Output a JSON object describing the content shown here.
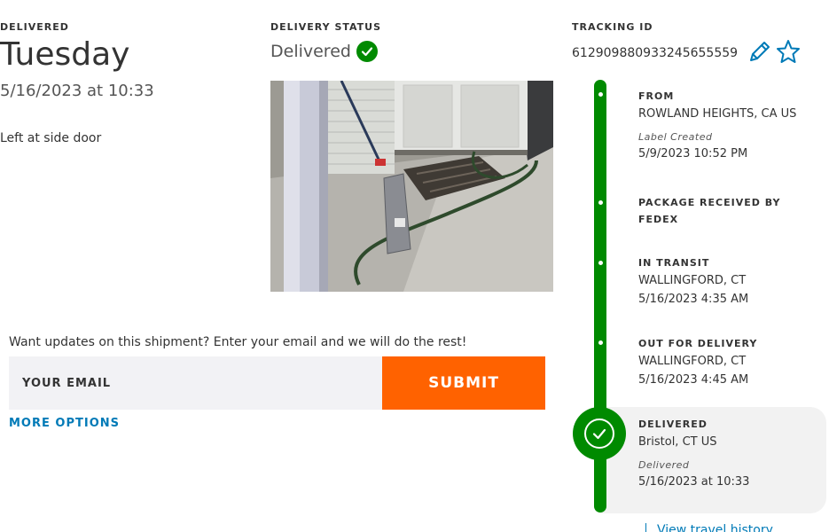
{
  "delivery": {
    "label": "DELIVERED",
    "day": "Tuesday",
    "datetime": "5/16/2023 at 10:33",
    "note": "Left at side door"
  },
  "status": {
    "label": "DELIVERY STATUS",
    "value": "Delivered",
    "icon": "check-circle-icon",
    "color": "#008a00"
  },
  "tracking": {
    "label": "TRACKING ID",
    "number": "612909880933245655559"
  },
  "updates": {
    "prompt": "Want updates on this shipment? Enter your email and we will do the rest!",
    "email_placeholder": "YOUR EMAIL",
    "submit_label": "SUBMIT",
    "more_options": "MORE OPTIONS"
  },
  "timeline": {
    "color": "#008a00",
    "events": [
      {
        "title": "FROM",
        "lines": [
          "ROWLAND HEIGHTS, CA US"
        ],
        "sublabel": "Label Created",
        "time": "5/9/2023 10:52 PM"
      },
      {
        "title": "PACKAGE RECEIVED BY FEDEX",
        "lines": [],
        "sublabel": "",
        "time": ""
      },
      {
        "title": "IN TRANSIT",
        "lines": [
          "WALLINGFORD, CT"
        ],
        "sublabel": "",
        "time": "5/16/2023 4:35 AM"
      },
      {
        "title": "OUT FOR DELIVERY",
        "lines": [
          "WALLINGFORD, CT"
        ],
        "sublabel": "",
        "time": "5/16/2023 4:45 AM"
      },
      {
        "title": "DELIVERED",
        "lines": [
          "Bristol, CT US"
        ],
        "sublabel": "Delivered",
        "time": "5/16/2023 at 10:33"
      }
    ],
    "view_history": "View travel history"
  },
  "colors": {
    "accent_orange": "#ff6200",
    "link_blue": "#007ab7",
    "success_green": "#008a00"
  }
}
